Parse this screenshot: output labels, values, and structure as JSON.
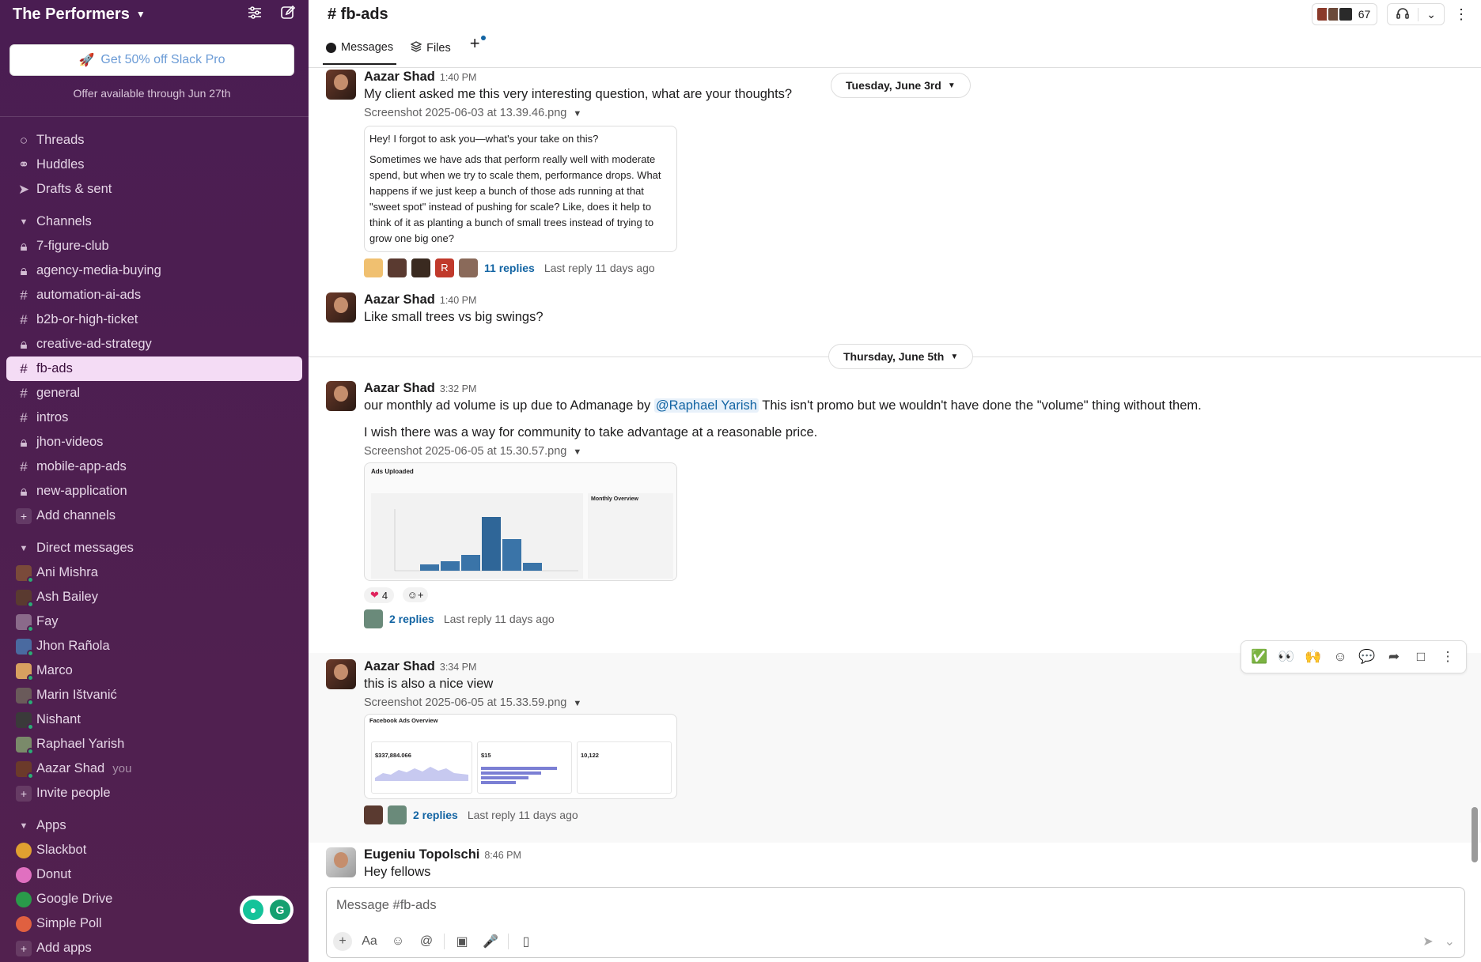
{
  "workspace": {
    "name": "The Performers"
  },
  "promo": {
    "button": "Get 50% off Slack Pro",
    "sub": "Offer available through Jun 27th"
  },
  "nav": [
    {
      "label": "Threads",
      "icon": "threads-icon"
    },
    {
      "label": "Huddles",
      "icon": "headphones-icon"
    },
    {
      "label": "Drafts & sent",
      "icon": "send-icon"
    }
  ],
  "channels": {
    "title": "Channels",
    "items": [
      {
        "label": "7-figure-club",
        "type": "lock"
      },
      {
        "label": "agency-media-buying",
        "type": "lock"
      },
      {
        "label": "automation-ai-ads",
        "type": "hash"
      },
      {
        "label": "b2b-or-high-ticket",
        "type": "hash"
      },
      {
        "label": "creative-ad-strategy",
        "type": "lock"
      },
      {
        "label": "fb-ads",
        "type": "hash",
        "active": true
      },
      {
        "label": "general",
        "type": "hash"
      },
      {
        "label": "intros",
        "type": "hash"
      },
      {
        "label": "jhon-videos",
        "type": "lock"
      },
      {
        "label": "mobile-app-ads",
        "type": "hash"
      },
      {
        "label": "new-application",
        "type": "lock"
      }
    ],
    "add": "Add channels"
  },
  "dms": {
    "title": "Direct messages",
    "items": [
      {
        "label": "Ani Mishra",
        "color": "#7a4a3a"
      },
      {
        "label": "Ash Bailey",
        "color": "#5a3a30"
      },
      {
        "label": "Fay",
        "color": "#8a6a8a"
      },
      {
        "label": "Jhon Rañola",
        "color": "#4a6aa0"
      },
      {
        "label": "Marco",
        "color": "#d8a060"
      },
      {
        "label": "Marin Ištvanić",
        "color": "#6a5a5a"
      },
      {
        "label": "Nishant",
        "color": "#3a3a3a"
      },
      {
        "label": "Raphael Yarish",
        "color": "#7a8a6a"
      },
      {
        "label": "Aazar Shad",
        "color": "#6b3a2a",
        "you": "you"
      }
    ],
    "invite": "Invite people"
  },
  "apps": {
    "title": "Apps",
    "items": [
      {
        "label": "Slackbot",
        "color": "#e0a030"
      },
      {
        "label": "Donut",
        "color": "#e070c0"
      },
      {
        "label": "Google Drive",
        "color": "#2a9a4a"
      },
      {
        "label": "Simple Poll",
        "color": "#e06040"
      }
    ],
    "add": "Add apps"
  },
  "channel": {
    "title": "# fb-ads",
    "member_count": "67",
    "tabs": {
      "messages": "Messages",
      "files": "Files"
    }
  },
  "dates": {
    "d1": "Tuesday, June 3rd",
    "d2": "Thursday, June 5th"
  },
  "messages": [
    {
      "author": "Aazar Shad",
      "time": "1:40 PM",
      "text": "My client asked me this very interesting question, what are your thoughts?",
      "file": "Screenshot 2025-06-03 at 13.39.46.png",
      "snippet_1": "Hey! I forgot to ask you—what's your take on this?",
      "snippet_2": "Sometimes we have ads that perform really well with moderate spend, but when we try to scale them, performance drops. What happens if we just keep a bunch of those ads running at that \"sweet spot\" instead of pushing for scale? Like, does it help to think of it as planting a bunch of small trees instead of trying to grow one big one?",
      "replies": "11 replies",
      "last_reply": "Last reply 11 days ago"
    },
    {
      "author": "Aazar Shad",
      "time": "1:40 PM",
      "text": "Like small trees vs big swings?"
    },
    {
      "author": "Aazar Shad",
      "time": "3:32 PM",
      "text_a": "our monthly ad volume is up due to Admanage by",
      "mention": "@Raphael Yarish",
      "text_b": "This isn't promo but we wouldn't have done the \"volume\" thing without them.",
      "text_2": "I wish there was a way for community to take advantage at a reasonable price.",
      "file": "Screenshot 2025-06-05 at 15.30.57.png",
      "thumb_title": "Ads Uploaded",
      "thumb_side": "Monthly Overview",
      "reaction_count": "4",
      "replies": "2 replies",
      "last_reply": "Last reply 11 days ago"
    },
    {
      "author": "Aazar Shad",
      "time": "3:34 PM",
      "text": "this is also a nice view",
      "file": "Screenshot 2025-06-05 at 15.33.59.png",
      "thumb_title": "Facebook Ads Overview",
      "thumb_spend": "$337,884.066",
      "thumb_accounts": "$15",
      "thumb_launched": "10,122",
      "replies": "2 replies",
      "last_reply": "Last reply 11 days ago"
    },
    {
      "author": "Eugeniu Topolschi",
      "time": "8:46 PM",
      "text": "Hey fellows"
    }
  ],
  "composer": {
    "placeholder": "Message #fb-ads"
  }
}
